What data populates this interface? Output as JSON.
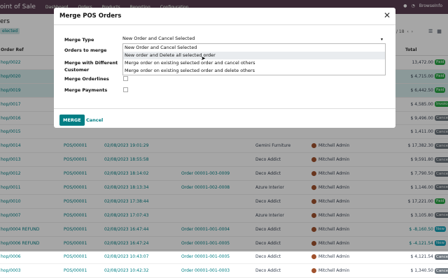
{
  "navbar": {
    "app_title": "oint of Sale",
    "menu": [
      "Dashboard",
      "Orders",
      "Products",
      "Reporting",
      "Configuration"
    ],
    "user": "BrowseInfo"
  },
  "crumb": "ers",
  "facet": "elected",
  "pager": "/ 18",
  "columns": {
    "ref": "Order Ref",
    "total": "Total"
  },
  "rows": [
    {
      "ref": "hop/0022",
      "session": "",
      "date": "",
      "receipt": "",
      "customer": "",
      "employee": "",
      "total": "13,472.00",
      "status": "Paid",
      "sel": false
    },
    {
      "ref": "hop/0020",
      "session": "",
      "date": "",
      "receipt": "",
      "customer": "",
      "employee": "",
      "total": "$ 4,715.00",
      "status": "Paid",
      "sel": true
    },
    {
      "ref": "hop/0019",
      "session": "",
      "date": "",
      "receipt": "",
      "customer": "",
      "employee": "",
      "total": "$ 6,442.50",
      "status": "Paid",
      "sel": true
    },
    {
      "ref": "hop/0017",
      "session": "",
      "date": "",
      "receipt": "",
      "customer": "",
      "employee": "",
      "total": "$ 4,585.00",
      "status": "Invoiced",
      "sel": false
    },
    {
      "ref": "hop/0016",
      "session": "",
      "date": "",
      "receipt": "",
      "customer": "",
      "employee": "",
      "total": "$ 9,496.00",
      "status": "Cancelled",
      "sel": false
    },
    {
      "ref": "hop/0015",
      "session": "",
      "date": "",
      "receipt": "",
      "customer": "",
      "employee": "",
      "total": "$ 1,411.00",
      "status": "Cancelled",
      "sel": false
    },
    {
      "ref": "hop/0014",
      "session": "POS/00001",
      "date": "02/08/2023 19:01:29",
      "receipt": "",
      "customer": "Gemini Furniture",
      "employee": "Mitchell Admin",
      "total": "$ 17,382.30",
      "status": "Cancelled",
      "sel": false
    },
    {
      "ref": "hop/0013",
      "session": "POS/00001",
      "date": "02/08/2023 18:55:58",
      "receipt": "",
      "customer": "Deco Addict",
      "employee": "Mitchell Admin",
      "total": "$ 9,591.80",
      "status": "Cancelled",
      "sel": false
    },
    {
      "ref": "hop/0012",
      "session": "POS/00001",
      "date": "02/08/2023 18:14:02",
      "receipt": "Order 00001-003-0009",
      "customer": "Deco Addict",
      "employee": "Mitchell Admin",
      "total": "$ 7,790.50",
      "status": "Cancelled",
      "sel": false
    },
    {
      "ref": "hop/0011",
      "session": "POS/00001",
      "date": "02/08/2023 18:13:34",
      "receipt": "Order 00001-002-0008",
      "customer": "Azure Interior",
      "employee": "Mitchell Admin",
      "total": "$ 1,146.00",
      "status": "Cancelled",
      "sel": false
    },
    {
      "ref": "hop/0010",
      "session": "POS/00001",
      "date": "02/08/2023 17:38:44",
      "receipt": "",
      "customer": "Deco Addict",
      "employee": "Mitchell Admin",
      "total": "$ 17,221.00",
      "status": "Paid",
      "sel": false
    },
    {
      "ref": "hop/0007",
      "session": "POS/00001",
      "date": "02/08/2023 17:07:43",
      "receipt": "",
      "customer": "Azure Interior",
      "employee": "Mitchell Admin",
      "total": "$ 3,105.80",
      "status": "Cancelled",
      "sel": false
    },
    {
      "ref": "hop/0004 REFUND",
      "session": "POS/00001",
      "date": "02/08/2023 16:47:44",
      "receipt": "Order 00001-001-0004",
      "customer": "Deco Addict",
      "employee": "Mitchell Admin",
      "total": "$ -8,160.50",
      "status": "New",
      "sel": false,
      "refund": true
    },
    {
      "ref": "hop/0006 REFUND",
      "session": "POS/00001",
      "date": "02/08/2023 16:47:24",
      "receipt": "Order 00001-001-0005",
      "customer": "Deco Addict",
      "employee": "Mitchell Admin",
      "total": "$ -4,121.54",
      "status": "New",
      "sel": false,
      "refund": true
    },
    {
      "ref": "hop/0006",
      "session": "POS/00001",
      "date": "02/08/2023 10:43:07",
      "receipt": "Order 00001-001-0005",
      "customer": "Deco Addict",
      "employee": "Mitchell Admin",
      "total": "$ 4,121.54",
      "status": "Cancelled",
      "sel": false
    },
    {
      "ref": "hop/0003",
      "session": "POS/00001",
      "date": "02/08/2023 10:42:32",
      "receipt": "Order 00001-001-0003",
      "customer": "Deco Addict",
      "employee": "Mitchell Admin",
      "total": "$ 1,340.50",
      "status": "Cancelled",
      "sel": false
    }
  ],
  "modal": {
    "title": "Merge POS Orders",
    "merge_type_label": "Merge Type",
    "merge_type_value": "New Order and Cancel Selected",
    "options": [
      "New Order and Cancel Selected",
      "New order and Delete all selected order",
      "Merge order on existing selected order and cancel others",
      "Merge order on existing selected order and delete others"
    ],
    "orders_label": "Orders to merge",
    "diff_customer_label_1": "Merge with Different",
    "diff_customer_label_2": "Customer",
    "orderlines_label": "Merge Orderlines",
    "payments_label": "Merge Payments",
    "merge_button": "MERGE",
    "cancel_button": "Cancel"
  }
}
